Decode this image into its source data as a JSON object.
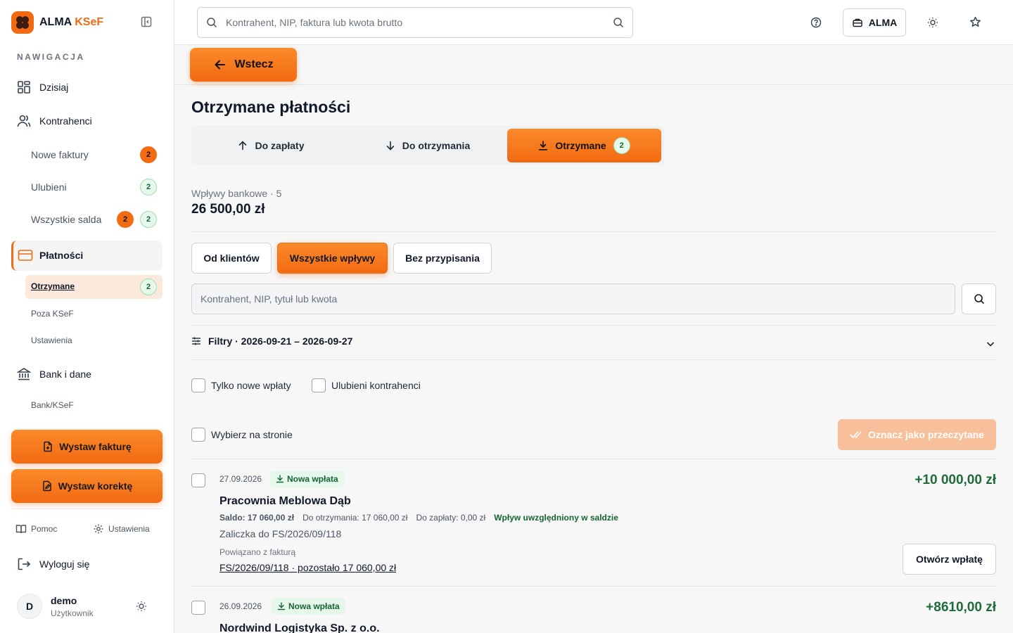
{
  "brand": {
    "name": "ALMA",
    "accent": "KSeF"
  },
  "nav": {
    "heading": "NAWIGACJA",
    "today": "Dzisiaj",
    "contractors": "Kontrahenci",
    "new_invoices": "Nowe faktury",
    "new_invoices_badge": "2",
    "favorites": "Ulubieni",
    "favorites_badge": "2",
    "all_balances": "Wszystkie salda",
    "all_balances_badge_o": "2",
    "all_balances_badge_g": "2",
    "payments": "Płatności",
    "received": "Otrzymane",
    "received_badge": "2",
    "outside_ksef": "Poza KSeF",
    "settings_sub": "Ustawienia",
    "bank": "Bank i dane",
    "bank_ksef": "Bank/KSeF"
  },
  "actions": {
    "issue_invoice": "Wystaw fakturę",
    "issue_correction": "Wystaw korektę"
  },
  "footer": {
    "help": "Pomoc",
    "settings": "Ustawienia",
    "logout": "Wyloguj się",
    "user_initial": "D",
    "user_name": "demo",
    "user_role": "Użytkownik"
  },
  "topbar": {
    "search_placeholder": "Kontrahent, NIP, faktura lub kwota brutto",
    "company": "ALMA"
  },
  "back": "Wstecz",
  "page": {
    "title": "Otrzymane płatności",
    "tabs": [
      {
        "label": "Do zapłaty"
      },
      {
        "label": "Do otrzymania"
      },
      {
        "label": "Otrzymane",
        "badge": "2"
      }
    ],
    "summary_label": "Wpływy bankowe · 5",
    "summary_value": "26 500,00 zł",
    "segments": [
      "Od klientów",
      "Wszystkie wpływy",
      "Bez przypisania"
    ],
    "search_placeholder": "Kontrahent, NIP, tytuł lub kwota",
    "filters": "Filtry · 2026-09-21 – 2026-09-27",
    "only_new": "Tylko nowe wpłaty",
    "fav_contractors": "Ulubieni kontrahenci",
    "select_page": "Wybierz na stronie",
    "mark_read": "Oznacz jako przeczytane"
  },
  "payments": [
    {
      "date": "27.09.2026",
      "status": "Nowa wpłata",
      "amount": "+10 000,00 zł",
      "party": "Pracownia Meblowa Dąb",
      "saldo": "Saldo: 17 060,00 zł",
      "to_receive": "Do otrzymania: 17 060,00 zł",
      "to_pay": "Do zapłaty: 0,00 zł",
      "included": "Wpływ uwzględniony w saldzie",
      "description": "Zaliczka do FS/2026/09/118",
      "link_label": "Powiązano z fakturą",
      "link": "FS/2026/09/118 · pozostało 17 060,00 zł",
      "open": "Otwórz wpłatę"
    },
    {
      "date": "26.09.2026",
      "status": "Nowa wpłata",
      "amount": "+8610,00 zł",
      "party": "Nordwind Logistyka Sp. z o.o."
    }
  ],
  "colors": {
    "accent": "#f26a12",
    "success": "#1f6b3a"
  }
}
